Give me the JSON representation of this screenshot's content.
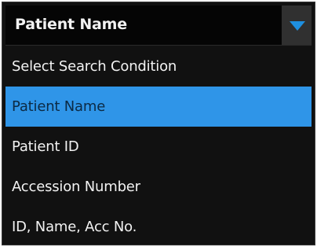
{
  "dropdown": {
    "selected_value": "Patient Name",
    "icon": "chevron-down-icon",
    "options": [
      {
        "label": "Select Search Condition"
      },
      {
        "label": "Patient Name"
      },
      {
        "label": "Patient ID"
      },
      {
        "label": "Accession Number"
      },
      {
        "label": "ID, Name, Acc No."
      }
    ],
    "highlighted_index": 1
  },
  "colors": {
    "background": "#111111",
    "highlight": "#2f95e8",
    "arrow": "#1e8fe0",
    "text": "#f2f2f2"
  }
}
